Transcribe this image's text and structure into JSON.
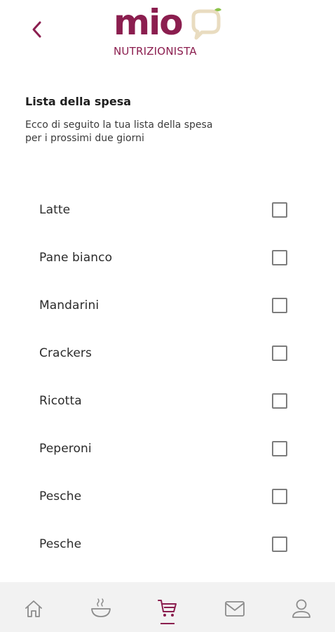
{
  "header": {
    "logo_word": "mio",
    "logo_subtitle": "NUTRIZIONISTA",
    "back_icon": "chevron-left-icon"
  },
  "intro": {
    "title": "Lista della spesa",
    "subtitle_line1": "Ecco di seguito la tua lista della spesa",
    "subtitle_line2": "per i prossimi due giorni"
  },
  "items": [
    {
      "label": "Latte",
      "checked": false
    },
    {
      "label": "Pane bianco",
      "checked": false
    },
    {
      "label": "Mandarini",
      "checked": false
    },
    {
      "label": "Crackers",
      "checked": false
    },
    {
      "label": "Ricotta",
      "checked": false
    },
    {
      "label": "Peperoni",
      "checked": false
    },
    {
      "label": "Pesche",
      "checked": false
    },
    {
      "label": "Pesche",
      "checked": false
    }
  ],
  "bottom_nav": {
    "items": [
      {
        "icon": "home-icon",
        "active": false
      },
      {
        "icon": "bowl-icon",
        "active": false
      },
      {
        "icon": "cart-icon",
        "active": true
      },
      {
        "icon": "mail-icon",
        "active": false
      },
      {
        "icon": "profile-icon",
        "active": false
      }
    ]
  },
  "colors": {
    "brand": "#8b1e4f",
    "nav_background": "#f2f2f2",
    "checkbox_border": "#7d7d7d",
    "logo_accent": "#e9dcc0",
    "logo_leaf": "#8bc34a"
  }
}
